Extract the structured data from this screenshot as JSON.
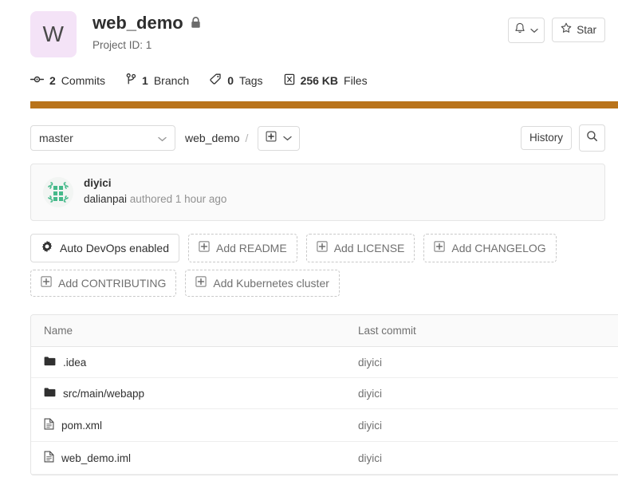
{
  "project": {
    "avatar_letter": "W",
    "avatar_bg": "#f4e3f7",
    "name": "web_demo",
    "visibility_icon": "lock-icon",
    "project_id_label": "Project ID: 1"
  },
  "header_actions": {
    "notify_icon": "bell-icon",
    "notify_caret_icon": "chevron-down-icon",
    "star_icon": "star-icon",
    "star_label": "Star"
  },
  "stats": [
    {
      "icon": "commit-icon",
      "value": "2",
      "label": "Commits"
    },
    {
      "icon": "branch-icon",
      "value": "1",
      "label": "Branch"
    },
    {
      "icon": "tag-icon",
      "value": "0",
      "label": "Tags"
    },
    {
      "icon": "files-icon",
      "value": "256 KB",
      "label": "Files"
    }
  ],
  "language_bar": [
    {
      "name": "primary",
      "color": "#b9731a",
      "percent": 100
    }
  ],
  "ref_row": {
    "branch": "master",
    "branch_caret_icon": "chevron-down-icon",
    "breadcrumb_root": "web_demo",
    "breadcrumb_separator": "/",
    "add_icon": "plus-square-icon",
    "add_caret_icon": "chevron-down-icon",
    "history_label": "History",
    "search_icon": "search-icon"
  },
  "last_commit": {
    "avatar_icon": "identicon-avatar",
    "title": "diyici",
    "author": "dalianpai",
    "meta": " authored 1 hour ago"
  },
  "quick_actions": [
    {
      "label": "Auto DevOps enabled",
      "icon": "gear-icon",
      "style": "solid"
    },
    {
      "label": "Add README",
      "icon": "plus-square-icon",
      "style": "dashed"
    },
    {
      "label": "Add LICENSE",
      "icon": "plus-square-icon",
      "style": "dashed"
    },
    {
      "label": "Add CHANGELOG",
      "icon": "plus-square-icon",
      "style": "dashed"
    },
    {
      "label": "Add CONTRIBUTING",
      "icon": "plus-square-icon",
      "style": "dashed"
    },
    {
      "label": "Add Kubernetes cluster",
      "icon": "plus-square-icon",
      "style": "dashed"
    }
  ],
  "file_tree": {
    "columns": [
      "Name",
      "Last commit"
    ],
    "rows": [
      {
        "type": "folder",
        "name": ".idea",
        "last_commit": "diyici"
      },
      {
        "type": "folder",
        "name": "src/main/webapp",
        "last_commit": "diyici"
      },
      {
        "type": "file",
        "name": "pom.xml",
        "last_commit": "diyici"
      },
      {
        "type": "file",
        "name": "web_demo.iml",
        "last_commit": "diyici"
      }
    ]
  }
}
